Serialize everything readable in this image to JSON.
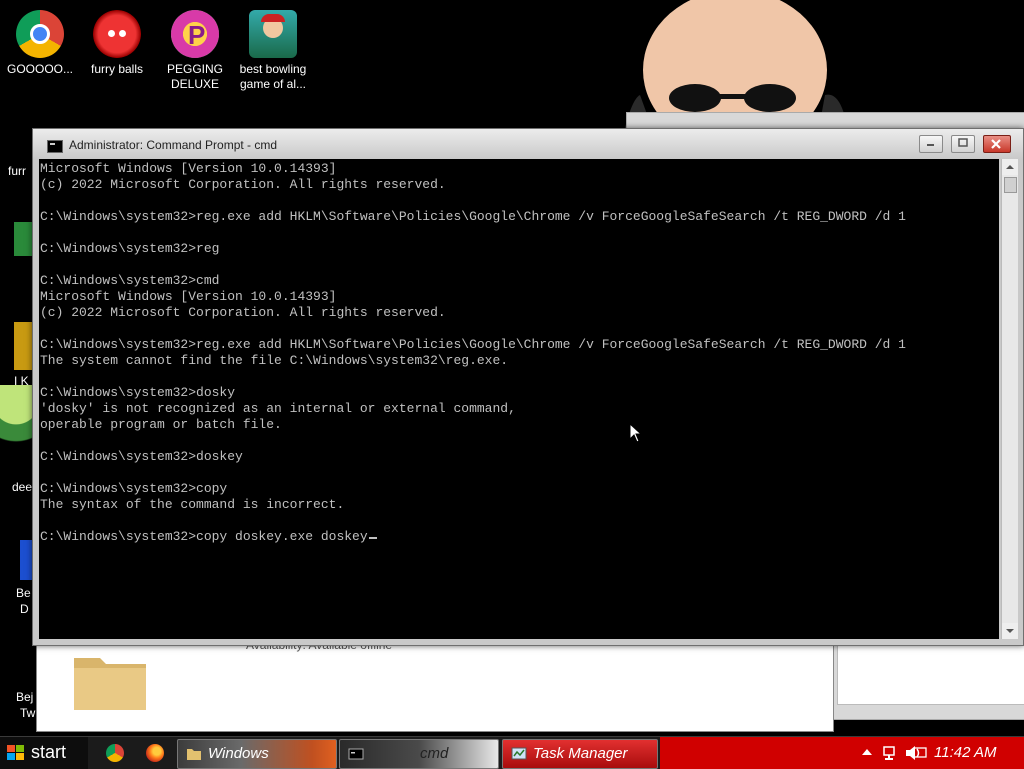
{
  "desktop": {
    "icons": [
      {
        "label": "GOOOOO...",
        "icon": "chrome-icon"
      },
      {
        "label": "furry balls",
        "icon": "furry-ball-icon"
      },
      {
        "label": "PEGGING DELUXE",
        "icon": "pegging-icon"
      },
      {
        "label": "best bowling game of al...",
        "icon": "bowling-icon"
      }
    ],
    "partial_labels": [
      "furr",
      "deel",
      "Be",
      "D",
      "Bej",
      "Tw",
      "I K"
    ]
  },
  "background_window": {
    "availability_text": "Availability: Available offline"
  },
  "cmd_window": {
    "title": "Administrator: Command Prompt - cmd",
    "lines": [
      "Microsoft Windows [Version 10.0.14393]",
      "(c) 2022 Microsoft Corporation. All rights reserved.",
      "",
      "C:\\Windows\\system32>reg.exe add HKLM\\Software\\Policies\\Google\\Chrome /v ForceGoogleSafeSearch /t REG_DWORD /d 1",
      "",
      "C:\\Windows\\system32>reg",
      "",
      "C:\\Windows\\system32>cmd",
      "Microsoft Windows [Version 10.0.14393]",
      "(c) 2022 Microsoft Corporation. All rights reserved.",
      "",
      "C:\\Windows\\system32>reg.exe add HKLM\\Software\\Policies\\Google\\Chrome /v ForceGoogleSafeSearch /t REG_DWORD /d 1",
      "The system cannot find the file C:\\Windows\\system32\\reg.exe.",
      "",
      "C:\\Windows\\system32>dosky",
      "'dosky' is not recognized as an internal or external command,",
      "operable program or batch file.",
      "",
      "C:\\Windows\\system32>doskey",
      "",
      "C:\\Windows\\system32>copy",
      "The syntax of the command is incorrect.",
      ""
    ],
    "current_input": "C:\\Windows\\system32>copy doskey.exe doskey"
  },
  "taskbar": {
    "start_label": "start",
    "pinned": [
      "chrome-icon",
      "firefox-icon"
    ],
    "tasks": [
      {
        "label": "Windows",
        "icon": "folder-icon"
      },
      {
        "label": "cmd",
        "icon": "cmd-icon"
      },
      {
        "label": "Task Manager",
        "icon": "task-manager-icon"
      }
    ],
    "tray_icons": [
      "show-hidden-icons-arrow",
      "network-icon",
      "speaker-icon",
      "screen-icon"
    ],
    "clock": "11:42 AM"
  },
  "colors": {
    "console_bg": "#000000",
    "console_text": "#c0c0c0",
    "close_button": "#c8382a",
    "tray_bg": "#d00000"
  }
}
